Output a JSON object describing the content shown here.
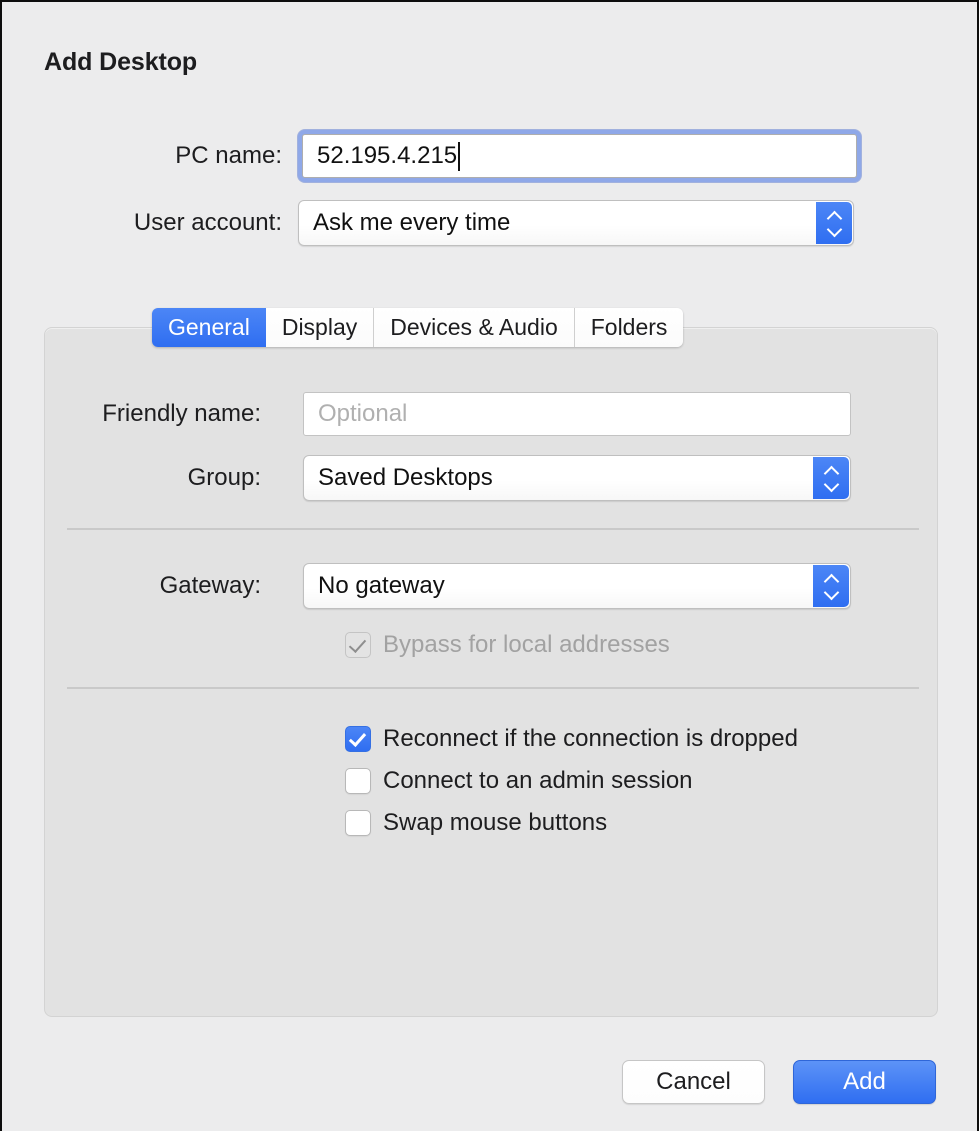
{
  "window": {
    "title": "Add Desktop"
  },
  "top_form": {
    "pc_name": {
      "label": "PC name:",
      "value": "52.195.4.215"
    },
    "user_account": {
      "label": "User account:",
      "value": "Ask me every time"
    }
  },
  "tabs": [
    {
      "label": "General",
      "active": true
    },
    {
      "label": "Display",
      "active": false
    },
    {
      "label": "Devices & Audio",
      "active": false
    },
    {
      "label": "Folders",
      "active": false
    }
  ],
  "general_tab": {
    "friendly_name": {
      "label": "Friendly name:",
      "value": "",
      "placeholder": "Optional"
    },
    "group": {
      "label": "Group:",
      "value": "Saved Desktops"
    },
    "gateway": {
      "label": "Gateway:",
      "value": "No gateway"
    },
    "bypass_local": {
      "label": "Bypass for local addresses",
      "checked": true,
      "disabled": true
    },
    "options": [
      {
        "label": "Reconnect if the connection is dropped",
        "checked": true
      },
      {
        "label": "Connect to an admin session",
        "checked": false
      },
      {
        "label": "Swap mouse buttons",
        "checked": false
      }
    ]
  },
  "footer": {
    "cancel_label": "Cancel",
    "add_label": "Add"
  },
  "colors": {
    "accent_blue": "#2f6ef1",
    "focus_ring": "#8fa8e8",
    "window_bg": "#ececed",
    "panel_bg": "#e2e2e2",
    "separator": "#c9c9c9",
    "placeholder_text": "#b0b0b0",
    "disabled_text": "#a2a2a2"
  }
}
